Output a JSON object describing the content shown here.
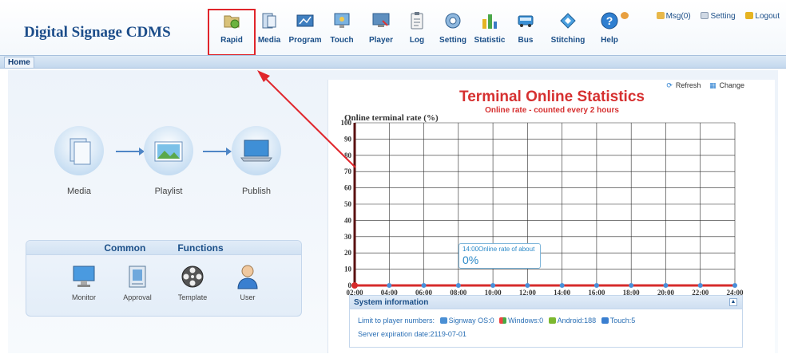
{
  "app": {
    "title": "Digital Signage CDMS"
  },
  "nav": [
    {
      "label": "Rapid",
      "icon": "rapid-icon"
    },
    {
      "label": "Media",
      "icon": "media-icon"
    },
    {
      "label": "Program",
      "icon": "program-icon"
    },
    {
      "label": "Touch",
      "icon": "touch-icon"
    },
    {
      "label": "Player",
      "icon": "player-icon"
    },
    {
      "label": "Log",
      "icon": "log-icon"
    },
    {
      "label": "Setting",
      "icon": "setting-icon"
    },
    {
      "label": "Statistic",
      "icon": "statistic-icon"
    },
    {
      "label": "Bus",
      "icon": "bus-icon"
    },
    {
      "label": "Stitching",
      "icon": "stitching-icon"
    },
    {
      "label": "Help",
      "icon": "help-icon"
    }
  ],
  "top_links": {
    "msg": "Msg(0)",
    "setting": "Setting",
    "logout": "Logout"
  },
  "tabs": {
    "home": "Home"
  },
  "workflow": {
    "steps": [
      "Media",
      "Playlist",
      "Publish"
    ]
  },
  "common_functions": {
    "title_left": "Common",
    "title_right": "Functions",
    "items": [
      "Monitor",
      "Approval",
      "Template",
      "User"
    ]
  },
  "chart_panel": {
    "refresh": "Refresh",
    "change": "Change"
  },
  "chart_data": {
    "type": "line",
    "title": "Terminal Online Statistics",
    "subtitle": "Online rate - counted every 2 hours",
    "ylabel": "Online terminal rate (%)",
    "xlabel": "",
    "ylim": [
      0,
      100
    ],
    "yticks": [
      0,
      10,
      20,
      30,
      40,
      50,
      60,
      70,
      80,
      90,
      100
    ],
    "categories": [
      "02:00",
      "04:00",
      "06:00",
      "08:00",
      "10:00",
      "12:00",
      "14:00",
      "16:00",
      "18:00",
      "20:00",
      "22:00",
      "24:00"
    ],
    "series": [
      {
        "values": [
          0,
          0,
          0,
          0,
          0,
          0,
          0,
          0,
          0,
          0,
          0,
          0
        ]
      }
    ],
    "grid": true,
    "colors": {
      "line": "#d62b2b",
      "point": "#4a90d9",
      "axis": "#5a1010"
    }
  },
  "tooltip": {
    "line1": "14:00Online rate of about",
    "value": "0%"
  },
  "system_info": {
    "title": "System information",
    "limit_label": "Limit to player numbers:",
    "signway": "Signway OS:0",
    "windows": "Windows:0",
    "android": "Android:188",
    "touch": "Touch:5",
    "expiration": "Server expiration date:2119-07-01"
  }
}
